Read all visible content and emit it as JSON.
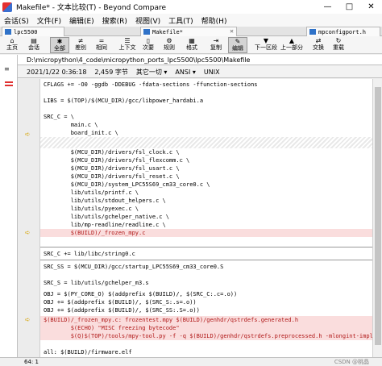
{
  "window": {
    "title": "Makefile* - 文本比较(T) - Beyond Compare",
    "controls": [
      "—",
      "□",
      "✕"
    ]
  },
  "menu": [
    "会话(S)",
    "文件(F)",
    "编辑(E)",
    "搜索(R)",
    "视图(V)",
    "工具(T)",
    "帮助(H)"
  ],
  "tabs": [
    {
      "label": "lpc5500"
    },
    {
      "label": "Makefile*"
    },
    {
      "label": "mpconfigport.h"
    }
  ],
  "toolbar": [
    {
      "label": "主页",
      "icon": "home-icon",
      "glyph": "⌂"
    },
    {
      "label": "会话",
      "icon": "session-icon",
      "glyph": "▤"
    },
    {
      "label": "全部",
      "icon": "all-icon",
      "glyph": "✱",
      "active": true
    },
    {
      "label": "差别",
      "icon": "diff-icon",
      "glyph": "≠"
    },
    {
      "label": "相同",
      "icon": "same-icon",
      "glyph": "="
    },
    {
      "label": "上下文",
      "icon": "context-icon",
      "glyph": "☰"
    },
    {
      "label": "次要",
      "icon": "minor-icon",
      "glyph": "▯"
    },
    {
      "label": "规则",
      "icon": "rules-icon",
      "glyph": "⚙"
    },
    {
      "label": "格式",
      "icon": "format-icon",
      "glyph": "▦"
    },
    {
      "label": "复制",
      "icon": "copy-icon",
      "glyph": "⇥"
    },
    {
      "label": "编辑",
      "icon": "edit-icon",
      "glyph": "✎",
      "active": true
    },
    {
      "label": "下一区段",
      "icon": "next-section-icon",
      "glyph": "▼"
    },
    {
      "label": "上一部分",
      "icon": "prev-section-icon",
      "glyph": "▲"
    },
    {
      "label": "交换",
      "icon": "swap-icon",
      "glyph": "⇄"
    },
    {
      "label": "重载",
      "icon": "reload-icon",
      "glyph": "↻"
    }
  ],
  "path": "D:\\micropython\\4_code\\micropython_ports_lpc5500\\lpc5500\\Makefile",
  "info": {
    "datetime": "2021/1/22 0:36:18",
    "size": "2,459 字节",
    "other": "其它一切",
    "encoding": "ANSI",
    "line_ending": "UNIX"
  },
  "code_lines": [
    "CFLAGS += -O0 -ggdb -DDEBUG -fdata-sections -ffunction-sections",
    "",
    "LIBS = $(TOP)/$(MCU_DIR)/gcc/libpower_hardabi.a",
    "",
    "SRC_C = \\",
    "        main.c \\",
    "        board_init.c \\",
    "",
    "        $(MCU_DIR)/drivers/fsl_clock.c \\",
    "        $(MCU_DIR)/drivers/fsl_flexcomm.c \\",
    "        $(MCU_DIR)/drivers/fsl_usart.c \\",
    "        $(MCU_DIR)/drivers/fsl_reset.c \\",
    "        $(MCU_DIR)/system_LPC55S69_cm33_core0.c \\",
    "        lib/utils/printf.c \\",
    "        lib/utils/stdout_helpers.c \\",
    "        lib/utils/pyexec.c \\",
    "        lib/utils/gchelper_native.c \\",
    "        lib/mp-readline/readline.c \\",
    "        $(BUILD)/_frozen_mpy.c",
    "",
    "SRC_C += lib/libc/string0.c",
    "",
    "SRC_SS = $(MCU_DIR)/gcc/startup_LPC55S69_cm33_core0.S",
    "",
    "SRC_S = lib/utils/gchelper_m3.s",
    "",
    "OBJ = $(PY_CORE_O) $(addprefix $(BUILD)/, $(SRC_C:.c=.o))",
    "OBJ += $(addprefix $(BUILD)/, $(SRC_S:.s=.o))",
    "OBJ += $(addprefix $(BUILD)/, $(SRC_SS:.S=.o))",
    "",
    "$(BUILD)/_frozen_mpy.c: frozentest.mpy $(BUILD)/genhdr/qstrdefs.generated.h",
    "        $(ECHO) \"MISC freezing bytecode\"",
    "        $(Q)$(TOP)/tools/mpy-tool.py -f -q $(BUILD)/genhdr/qstrdefs.preprocessed.h -mlongint-impl=none $",
    "",
    "all: $(BUILD)/firmware.elf"
  ],
  "status": {
    "position": "64: 1",
    "watermark": "CSDN @桃晶"
  }
}
